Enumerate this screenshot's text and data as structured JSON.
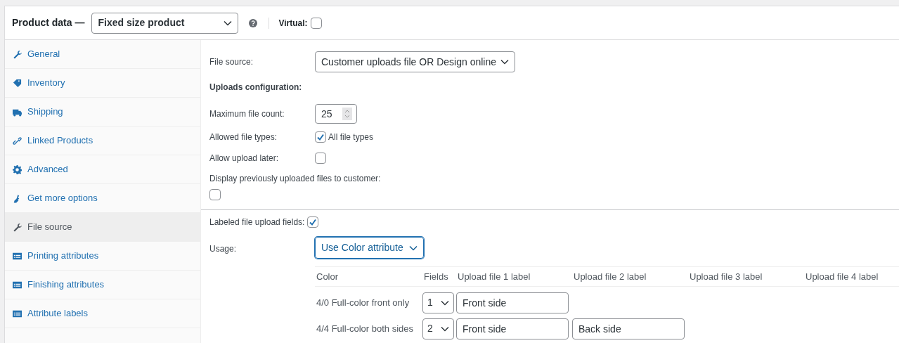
{
  "header": {
    "title": "Product data —",
    "product_type": "Fixed size product",
    "virtual": {
      "label": "Virtual:",
      "checked": false
    }
  },
  "sidebar": {
    "items": [
      {
        "label": "General",
        "selected": false
      },
      {
        "label": "Inventory",
        "selected": false
      },
      {
        "label": "Shipping",
        "selected": false
      },
      {
        "label": "Linked Products",
        "selected": false
      },
      {
        "label": "Advanced",
        "selected": false
      },
      {
        "label": "Get more options",
        "selected": false
      },
      {
        "label": "File source",
        "selected": true
      },
      {
        "label": "Printing attributes",
        "selected": false
      },
      {
        "label": "Finishing attributes",
        "selected": false
      },
      {
        "label": "Attribute labels",
        "selected": false
      }
    ]
  },
  "file_source": {
    "label": "File source:",
    "value": "Customer uploads file OR Design online"
  },
  "uploads_configuration": {
    "heading": "Uploads configuration:",
    "max_file_count": {
      "label": "Maximum file count:",
      "value": "25"
    },
    "allowed_file_types": {
      "label": "Allowed file types:",
      "option": "All file types",
      "checked": true
    },
    "allow_upload_later": {
      "label": "Allow upload later:",
      "checked": false
    },
    "display_previous": {
      "label": "Display previously uploaded files to customer:",
      "checked": false
    }
  },
  "labeled_fields": {
    "label": "Labeled file upload fields:",
    "checked": true
  },
  "usage": {
    "label": "Usage:",
    "value": "Use Color attribute"
  },
  "table": {
    "columns": [
      "Color",
      "Fields",
      "Upload file 1 label",
      "Upload file 2 label",
      "Upload file 3 label",
      "Upload file 4 label"
    ],
    "rows": [
      {
        "color_option": "4/0 Full-color front only",
        "fields": "1",
        "upload_labels": [
          "Front side"
        ]
      },
      {
        "color_option": "4/4 Full-color both sides",
        "fields": "2",
        "upload_labels": [
          "Front side",
          "Back side"
        ]
      }
    ]
  }
}
